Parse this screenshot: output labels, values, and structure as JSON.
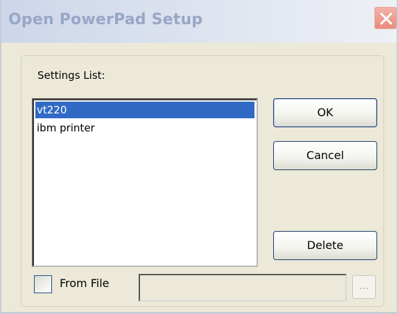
{
  "window": {
    "title": "Open PowerPad Setup",
    "close_icon": "close-x-icon"
  },
  "settings": {
    "label": "Settings List:",
    "items": [
      {
        "label": "vt220",
        "selected": true
      },
      {
        "label": "ibm printer",
        "selected": false
      }
    ]
  },
  "buttons": {
    "ok_label": "OK",
    "cancel_label": "Cancel",
    "delete_label": "Delete",
    "browse_label": "..."
  },
  "from_file": {
    "label": "From File",
    "checked": false,
    "path_value": ""
  },
  "colors": {
    "selection": "#316ac5",
    "dialog_background": "#ece9d8",
    "close_button": "#e98b7e"
  }
}
